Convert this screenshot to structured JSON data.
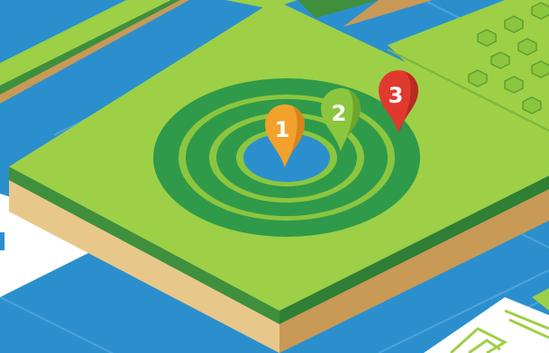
{
  "pins": [
    {
      "label": "1",
      "color": "#f2a22c",
      "shade": "#d9841a"
    },
    {
      "label": "2",
      "color": "#8cc63f",
      "shade": "#6ea62a"
    },
    {
      "label": "3",
      "color": "#e03a2f",
      "shade": "#b82a22"
    }
  ],
  "colors": {
    "water": "#2b8fce",
    "grass": "#9dd046",
    "grass_side_dark": "#3f8f3c",
    "soil": "#e8c88a",
    "soil_dark": "#c99a55",
    "ring_dark": "#2f9a4a",
    "ring_light": "#8cc63f",
    "ring_center": "#2b8fce",
    "bush": "#8cc63f",
    "path_white": "#ffffff"
  }
}
